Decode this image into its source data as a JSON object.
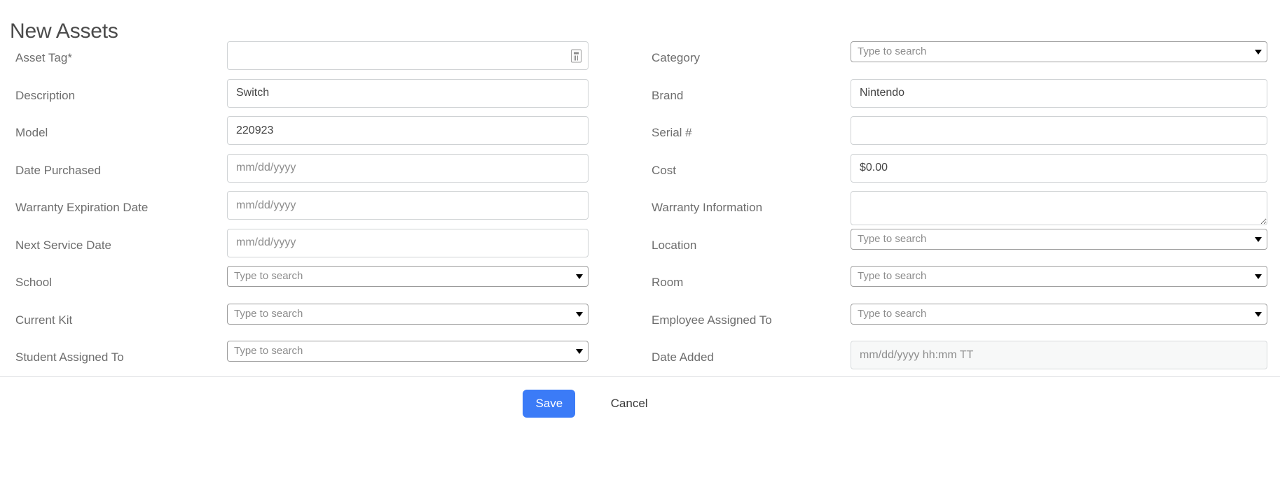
{
  "header": {
    "title": "New Assets"
  },
  "form": {
    "rows": [
      {
        "left": {
          "label": "Asset Tag*",
          "type": "text-scan",
          "value": "",
          "placeholder": "",
          "icon": "barcode-scan-icon",
          "name": "asset-tag"
        },
        "right": {
          "label": "Category",
          "type": "select",
          "value": "Type to search",
          "name": "category"
        }
      },
      {
        "left": {
          "label": "Description",
          "type": "text",
          "value": "Switch",
          "placeholder": "",
          "name": "description"
        },
        "right": {
          "label": "Brand",
          "type": "text",
          "value": "Nintendo",
          "placeholder": "",
          "name": "brand"
        }
      },
      {
        "left": {
          "label": "Model",
          "type": "text",
          "value": "220923",
          "placeholder": "",
          "name": "model"
        },
        "right": {
          "label": "Serial #",
          "type": "text",
          "value": "",
          "placeholder": "",
          "name": "serial-number"
        }
      },
      {
        "left": {
          "label": "Date Purchased",
          "type": "text",
          "value": "",
          "placeholder": "mm/dd/yyyy",
          "name": "date-purchased"
        },
        "right": {
          "label": "Cost",
          "type": "text",
          "value": "$0.00",
          "placeholder": "",
          "name": "cost"
        }
      },
      {
        "left": {
          "label": "Warranty Expiration Date",
          "type": "text",
          "value": "",
          "placeholder": "mm/dd/yyyy",
          "name": "warranty-expiration-date"
        },
        "right": {
          "label": "Warranty Information",
          "type": "textarea",
          "value": "",
          "placeholder": "",
          "name": "warranty-information"
        }
      },
      {
        "left": {
          "label": "Next Service Date",
          "type": "text",
          "value": "",
          "placeholder": "mm/dd/yyyy",
          "name": "next-service-date"
        },
        "right": {
          "label": "Location",
          "type": "select",
          "value": "Type to search",
          "name": "location"
        }
      },
      {
        "left": {
          "label": "School",
          "type": "select",
          "value": "Type to search",
          "name": "school"
        },
        "right": {
          "label": "Room",
          "type": "select",
          "value": "Type to search",
          "name": "room"
        }
      },
      {
        "left": {
          "label": "Current Kit",
          "type": "select",
          "value": "Type to search",
          "name": "current-kit"
        },
        "right": {
          "label": "Employee Assigned To",
          "type": "select",
          "value": "Type to search",
          "name": "employee-assigned-to"
        }
      },
      {
        "left": {
          "label": "Student Assigned To",
          "type": "select",
          "value": "Type to search",
          "name": "student-assigned-to"
        },
        "right": {
          "label": "Date Added",
          "type": "text-disabled",
          "value": "",
          "placeholder": "mm/dd/yyyy hh:mm TT",
          "name": "date-added"
        }
      }
    ]
  },
  "footer": {
    "save_label": "Save",
    "cancel_label": "Cancel"
  },
  "colors": {
    "save_button": "#3b7bf7",
    "label_text": "#6d6d6d",
    "input_border": "#cfd2d4",
    "select_border": "#9b9b9b",
    "disabled_background": "#f7f8f8"
  }
}
